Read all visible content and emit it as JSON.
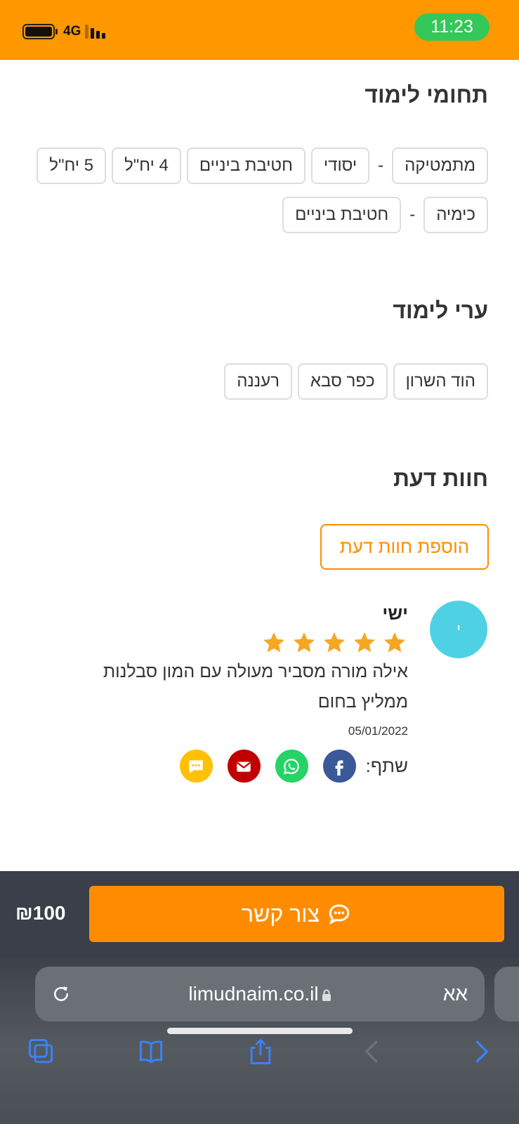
{
  "status_bar": {
    "network": "4G",
    "time": "11:23"
  },
  "subjects": {
    "title": "תחומי לימוד",
    "row1": [
      {
        "label": "מתמטיקה",
        "sep": "-"
      },
      {
        "label": "יסודי"
      },
      {
        "label": "חטיבת ביניים"
      },
      {
        "label": "4 יח\"ל"
      },
      {
        "label": "5 יח\"ל"
      }
    ],
    "row2": [
      {
        "label": "כימיה",
        "sep": "-"
      },
      {
        "label": "חטיבת ביניים"
      }
    ]
  },
  "cities": {
    "title": "ערי לימוד",
    "items": [
      "הוד השרון",
      "כפר סבא",
      "רעננה"
    ]
  },
  "reviews": {
    "title": "חוות דעת",
    "add_button": "הוספת חוות דעת",
    "items": [
      {
        "avatar_letter": "י",
        "name": "ישי",
        "rating": 5,
        "text": "אילה מורה מסביר מעולה עם המון סבלנות ממליץ בחום",
        "text_line1": "אילה מורה מסביר מעולה עם המון סבלנות",
        "text_line2": "ממליץ בחום",
        "date": "05/01/2022"
      }
    ],
    "share_label": "שתף:",
    "share_buttons": [
      {
        "icon": "facebook-icon",
        "color": "#3b5998"
      },
      {
        "icon": "whatsapp-icon",
        "color": "#25d366"
      },
      {
        "icon": "email-icon",
        "color": "#c00000"
      },
      {
        "icon": "sms-icon",
        "color": "#ffc107"
      }
    ]
  },
  "action_bar": {
    "price": "₪100",
    "contact_label": "צור קשר",
    "accent": "#ff8c00"
  },
  "browser": {
    "aa_label": "אא",
    "url": "limudnaim.co.il"
  }
}
